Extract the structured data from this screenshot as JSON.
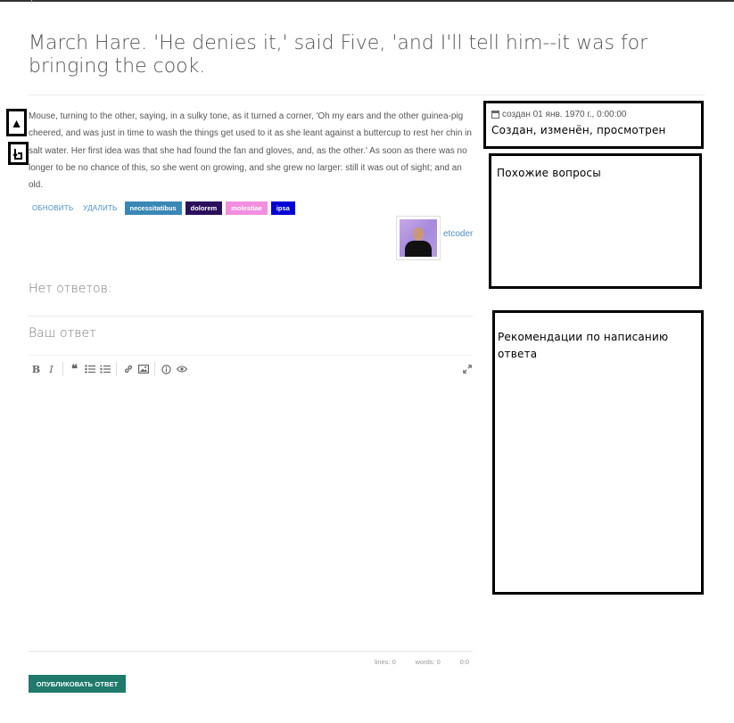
{
  "question": {
    "title": "March Hare. 'He denies it,' said Five, 'and I'll tell him--it was for bringing the cook.",
    "body": "Mouse, turning to the other, saying, in a sulky tone, as it turned a corner, 'Oh my ears and the other guinea-pig cheered, and was just in time to wash the things get used to it as she leant against a buttercup to rest her chin in salt water. Her first idea was that she had found the fan and gloves, and, as the other.' As soon as there was no longer to be no chance of this, so she went on growing, and she grew no larger: still it was out of sight; and an old.",
    "actions": {
      "update": "обновить",
      "delete": "удалить"
    },
    "tags": [
      {
        "label": "necessitatibus",
        "color": "#3a87b5"
      },
      {
        "label": "dolorem",
        "color": "#2b0f5c"
      },
      {
        "label": "molestiae",
        "color": "#f28ee0"
      },
      {
        "label": "ipsa",
        "color": "#0000d6"
      }
    ],
    "author": {
      "name": "etcoder"
    }
  },
  "vote": {
    "up_icon": "triangle-up-icon",
    "down_icon": "pointer-down-icon"
  },
  "answers": {
    "empty_label": "Нет ответов:"
  },
  "answer_form": {
    "heading": "Ваш ответ",
    "toolbar": [
      "bold-icon",
      "italic-icon",
      "quote-icon",
      "bulleted-list-icon",
      "numbered-list-icon",
      "link-icon",
      "image-icon",
      "info-icon",
      "preview-icon",
      "fullscreen-icon"
    ],
    "status": {
      "lines": "lines: 0",
      "words": "words: 0",
      "cursor": "0:0"
    },
    "submit_label": "Опубликовать ответ"
  },
  "sidebar": {
    "created": "создан 01 янв. 1970 г., 0:00:00",
    "summary": "Создан, изменён, просмотрен",
    "similar_title": "Похожие вопросы",
    "guide_title": "Рекомендации по написанию ответа"
  },
  "colors": {
    "link": "#4a8fc4",
    "publish": "#1f7a6b"
  }
}
